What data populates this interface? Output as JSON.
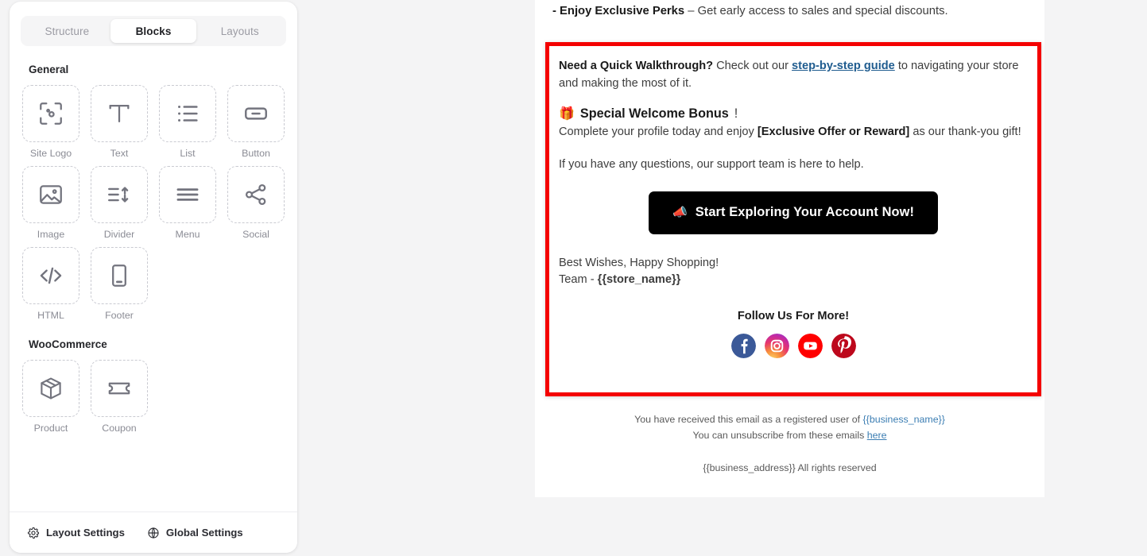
{
  "sidebar": {
    "tabs": [
      {
        "label": "Structure",
        "active": false
      },
      {
        "label": "Blocks",
        "active": true
      },
      {
        "label": "Layouts",
        "active": false
      }
    ],
    "sections": [
      {
        "title": "General",
        "items": [
          {
            "label": "Site Logo",
            "icon": "site-logo-icon"
          },
          {
            "label": "Text",
            "icon": "text-icon"
          },
          {
            "label": "List",
            "icon": "list-icon"
          },
          {
            "label": "Button",
            "icon": "button-icon"
          },
          {
            "label": "Image",
            "icon": "image-icon"
          },
          {
            "label": "Divider",
            "icon": "divider-icon"
          },
          {
            "label": "Menu",
            "icon": "menu-icon"
          },
          {
            "label": "Social",
            "icon": "social-icon"
          },
          {
            "label": "HTML",
            "icon": "html-code-icon"
          },
          {
            "label": "Footer",
            "icon": "footer-icon"
          }
        ]
      },
      {
        "title": "WooCommerce",
        "items": [
          {
            "label": "Product",
            "icon": "product-box-icon"
          },
          {
            "label": "Coupon",
            "icon": "coupon-ticket-icon"
          }
        ]
      }
    ],
    "footer": {
      "layout_settings": "Layout Settings",
      "global_settings": "Global Settings"
    }
  },
  "email": {
    "top_paragraph": {
      "bold": "- Enjoy Exclusive Perks",
      "rest": " – Get early access to sales and special discounts."
    },
    "selected_block": {
      "walkthrough": {
        "bold_lead": "Need a Quick Walkthrough?",
        "mid": " Check out our ",
        "link": "step-by-step guide",
        "tail": " to navigating your store and making the most of it."
      },
      "bonus": {
        "emoji": "🎁",
        "heading": "Special Welcome Bonus",
        "heading_bang": "!",
        "body_lead": "Complete your profile today and enjoy ",
        "body_bold": "[Exclusive Offer or Reward]",
        "body_tail": " as our thank-you gift!"
      },
      "support_line": "If you have any questions, our support team is here to help.",
      "cta": {
        "emoji": "📣",
        "label": "Start Exploring Your Account Now!"
      },
      "signoff_line1": "Best Wishes, Happy Shopping!",
      "signoff_line2_lead": "Team - ",
      "signoff_line2_bold": "{{store_name}}",
      "follow_title": "Follow Us For More!",
      "socials": [
        {
          "name": "facebook-icon",
          "color": "#3b5998"
        },
        {
          "name": "instagram-icon",
          "color": "#d6249f"
        },
        {
          "name": "youtube-icon",
          "color": "#ff0000"
        },
        {
          "name": "pinterest-icon",
          "color": "#bd081c"
        }
      ]
    },
    "footer": {
      "line1_lead": "You have received this email as a registered user of ",
      "line1_token": "{{business_name}}",
      "line2_lead": "You can unsubscribe from these emails ",
      "line2_link": "here",
      "line3": "{{business_address}} All rights reserved"
    }
  },
  "colors": {
    "selection_red": "#f40000",
    "link_blue": "#1f5c8f",
    "footer_link_blue": "#3c7eb3",
    "cta_background": "#000000",
    "page_background": "#f4f4f5"
  }
}
